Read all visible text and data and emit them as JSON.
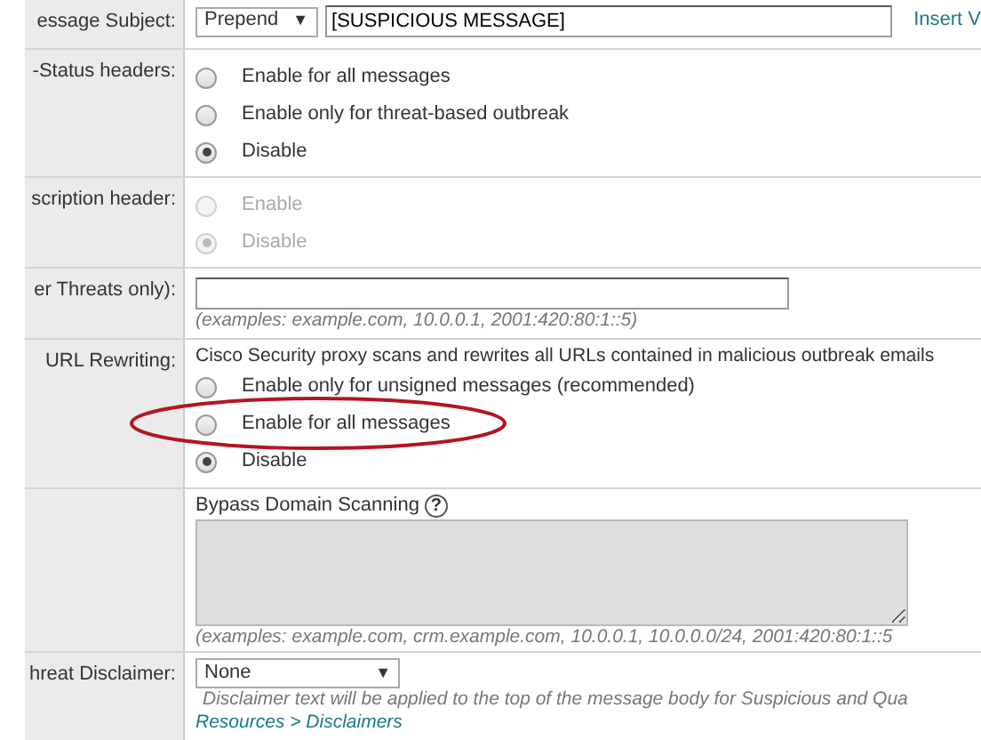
{
  "rows": [
    {
      "kind": "subject",
      "label": "essage Subject:",
      "mode": "Prepend",
      "caret": "▼",
      "value": "[SUSPICIOUS MESSAGE]",
      "link": "Insert V"
    },
    {
      "kind": "radios",
      "label": "-Status headers:",
      "options": [
        {
          "label": "Enable for all messages",
          "selected": false,
          "disabled": false
        },
        {
          "label": "Enable only for threat-based outbreak",
          "selected": false,
          "disabled": false
        },
        {
          "label": "Disable",
          "selected": true,
          "disabled": false
        }
      ]
    },
    {
      "kind": "radios",
      "label": "scription header:",
      "options": [
        {
          "label": "Enable",
          "selected": false,
          "disabled": true
        },
        {
          "label": "Disable",
          "selected": true,
          "disabled": true
        }
      ]
    },
    {
      "kind": "text",
      "label": "er Threats only):",
      "hint": "(examples: example.com, 10.0.0.1, 2001:420:80:1::5)"
    },
    {
      "kind": "url",
      "label": "URL Rewriting:",
      "description": "Cisco Security proxy scans and rewrites all URLs contained in malicious outbreak emails",
      "options": [
        {
          "label": "Enable only for unsigned messages (recommended)",
          "selected": false,
          "disabled": false,
          "highlighted": false
        },
        {
          "label": "Enable for all messages",
          "selected": false,
          "disabled": false,
          "highlighted": true
        },
        {
          "label": "Disable",
          "selected": true,
          "disabled": false,
          "highlighted": false
        }
      ]
    },
    {
      "kind": "bypass",
      "title": "Bypass Domain Scanning",
      "help": "?",
      "hint": "(examples: example.com, crm.example.com, 10.0.0.1, 10.0.0.0/24, 2001:420:80:1::5"
    },
    {
      "kind": "select",
      "label": "hreat Disclaimer:",
      "value": "None",
      "caret": "▼",
      "note": "Disclaimer text will be applied to the top of the message body for Suspicious and Qua",
      "link": "Resources > Disclaimers"
    }
  ]
}
